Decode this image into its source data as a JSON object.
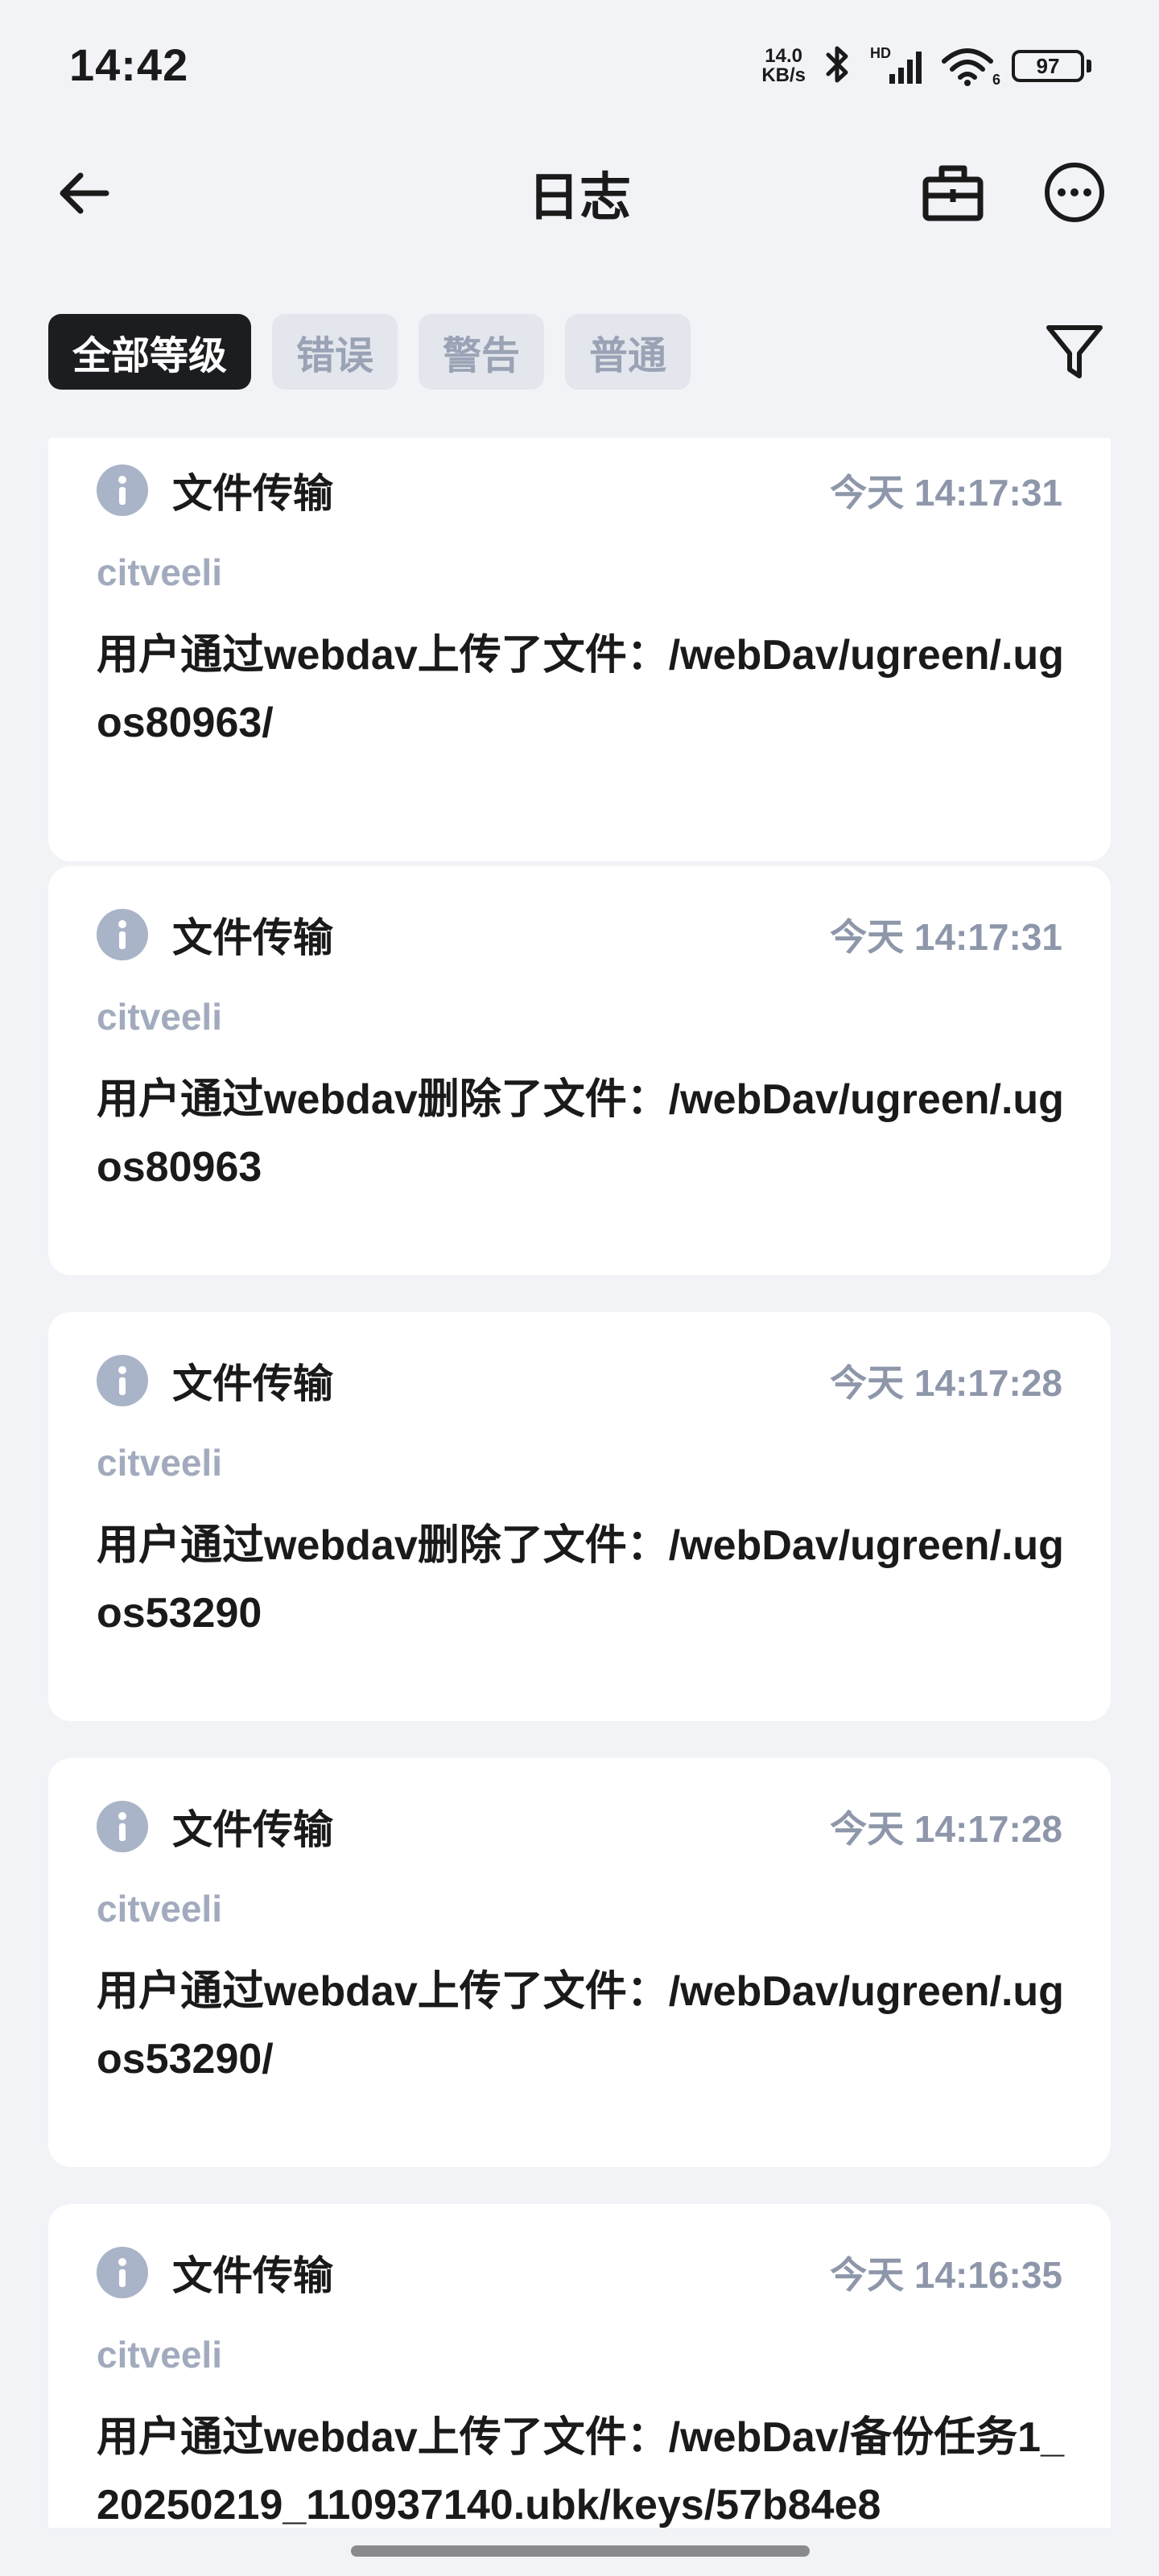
{
  "status_bar": {
    "time": "14:42",
    "net_speed_value": "14.0",
    "net_speed_unit": "KB/s",
    "signal_label": "HD",
    "wifi_label": "6",
    "battery": "97"
  },
  "header": {
    "title": "日志"
  },
  "filters": {
    "tabs": [
      {
        "label": "全部等级",
        "active": true
      },
      {
        "label": "错误",
        "active": false
      },
      {
        "label": "警告",
        "active": false
      },
      {
        "label": "普通",
        "active": false
      }
    ]
  },
  "logs": [
    {
      "type": "文件传输",
      "time": "今天 14:17:31",
      "user": "citveeli",
      "message": "用户通过webdav上传了文件：/webDav/ugreen/.ugos80963/"
    },
    {
      "type": "文件传输",
      "time": "今天 14:17:31",
      "user": "citveeli",
      "message": "用户通过webdav删除了文件：/webDav/ugreen/.ugos80963"
    },
    {
      "type": "文件传输",
      "time": "今天 14:17:28",
      "user": "citveeli",
      "message": "用户通过webdav删除了文件：/webDav/ugreen/.ugos53290"
    },
    {
      "type": "文件传输",
      "time": "今天 14:17:28",
      "user": "citveeli",
      "message": "用户通过webdav上传了文件：/webDav/ugreen/.ugos53290/"
    },
    {
      "type": "文件传输",
      "time": "今天 14:16:35",
      "user": "citveeli",
      "message": "用户通过webdav上传了文件：/webDav/备份任务1_20250219_110937140.ubk/keys/57b84e8"
    }
  ],
  "colors": {
    "background": "#f2f3f7",
    "active_chip": "#1c1d20",
    "inactive_chip": "#e3e6ec",
    "info_icon": "#aab4c8",
    "muted_text": "#8e97aa"
  }
}
